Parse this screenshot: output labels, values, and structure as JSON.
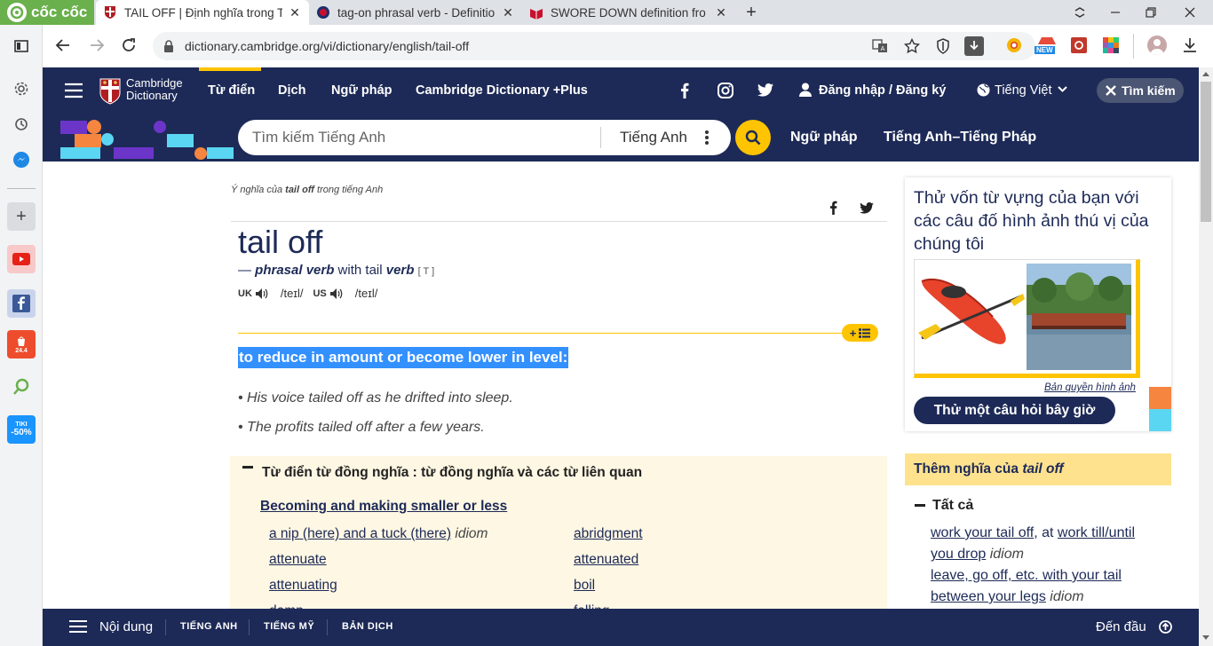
{
  "browser": {
    "brand": "cốc cốc",
    "tabs": [
      {
        "title": "TAIL OFF | Định nghĩa trong T",
        "active": true
      },
      {
        "title": "tag-on phrasal verb - Definitio",
        "active": false
      },
      {
        "title": "SWORE DOWN definition fro",
        "active": false
      }
    ],
    "url": "dictionary.cambridge.org/vi/dictionary/english/tail-off",
    "new_badge": "NEW"
  },
  "sidebar": {
    "shopee_badge": "24.4",
    "tiki_label": "TIKI",
    "tiki_badge": "-50%"
  },
  "header": {
    "logo_line1": "Cambridge",
    "logo_line2": "Dictionary",
    "nav": [
      "Từ điển",
      "Dịch",
      "Ngữ pháp",
      "Cambridge Dictionary +Plus"
    ],
    "login": "Đăng nhập / Đăng ký",
    "language": "Tiếng Việt",
    "search_toggle": "Tìm kiếm",
    "search_placeholder": "Tìm kiếm Tiếng Anh",
    "search_lang": "Tiếng Anh",
    "nav2": [
      "Ngữ pháp",
      "Tiếng Anh–Tiếng Pháp"
    ]
  },
  "entry": {
    "breadcrumb_pre": "Ý nghĩa của ",
    "breadcrumb_word": "tail off",
    "breadcrumb_post": " trong tiếng Anh",
    "headword": "tail off",
    "pos_dash": "— ",
    "pos": "phrasal verb",
    "pos_with": " with tail ",
    "pos_verb": "verb",
    "pos_code": "[ T ]",
    "uk_label": "UK",
    "uk_ipa": "/teɪl/",
    "us_label": "US",
    "us_ipa": "/teɪl/",
    "definition": "to reduce in amount or become lower in level:",
    "examples": [
      "His voice tailed off as he drifted into sleep.",
      "The profits tailed off after a few years."
    ]
  },
  "thesaurus": {
    "heading": "Từ điển từ đồng nghĩa : từ đồng nghĩa và các từ liên quan",
    "subheading": "Becoming and making smaller or less",
    "items_left": [
      {
        "text": "a nip (here) and a tuck (there)",
        "tag": "idiom"
      },
      {
        "text": "attenuate",
        "tag": ""
      },
      {
        "text": "attenuating",
        "tag": ""
      },
      {
        "text": "damp",
        "tag": ""
      }
    ],
    "items_right": [
      {
        "text": "abridgment",
        "tag": ""
      },
      {
        "text": "attenuated",
        "tag": ""
      },
      {
        "text": "boil",
        "tag": ""
      },
      {
        "text": "falling",
        "tag": ""
      }
    ]
  },
  "quiz": {
    "text": "Thử vốn từ vựng của bạn với các câu đố hình ảnh thú vị của chúng tôi",
    "credit": "Bản quyền hình ảnh",
    "button": "Thử một câu hỏi bây giờ"
  },
  "more_meanings": {
    "heading_pre": "Thêm nghĩa của ",
    "heading_word": "tail off",
    "all_label": "Tất cả",
    "line1_a": "work your tail off",
    "line1_sep": ", at ",
    "line1_b": "work till/until",
    "line2_a": "you drop",
    "line2_tag": " idiom",
    "line3": "leave, go off, etc. with your tail",
    "line4_a": "between your legs",
    "line4_tag": " idiom"
  },
  "bottombar": {
    "contents": "Nội dung",
    "links": [
      "TIẾNG ANH",
      "TIẾNG MỸ",
      "BẢN DỊCH"
    ],
    "top": "Đến đầu"
  },
  "colors": {
    "navy": "#1d2a57",
    "yellow": "#fec400",
    "highlight": "#3390ff",
    "thesaurus_bg": "#fef7e3"
  }
}
